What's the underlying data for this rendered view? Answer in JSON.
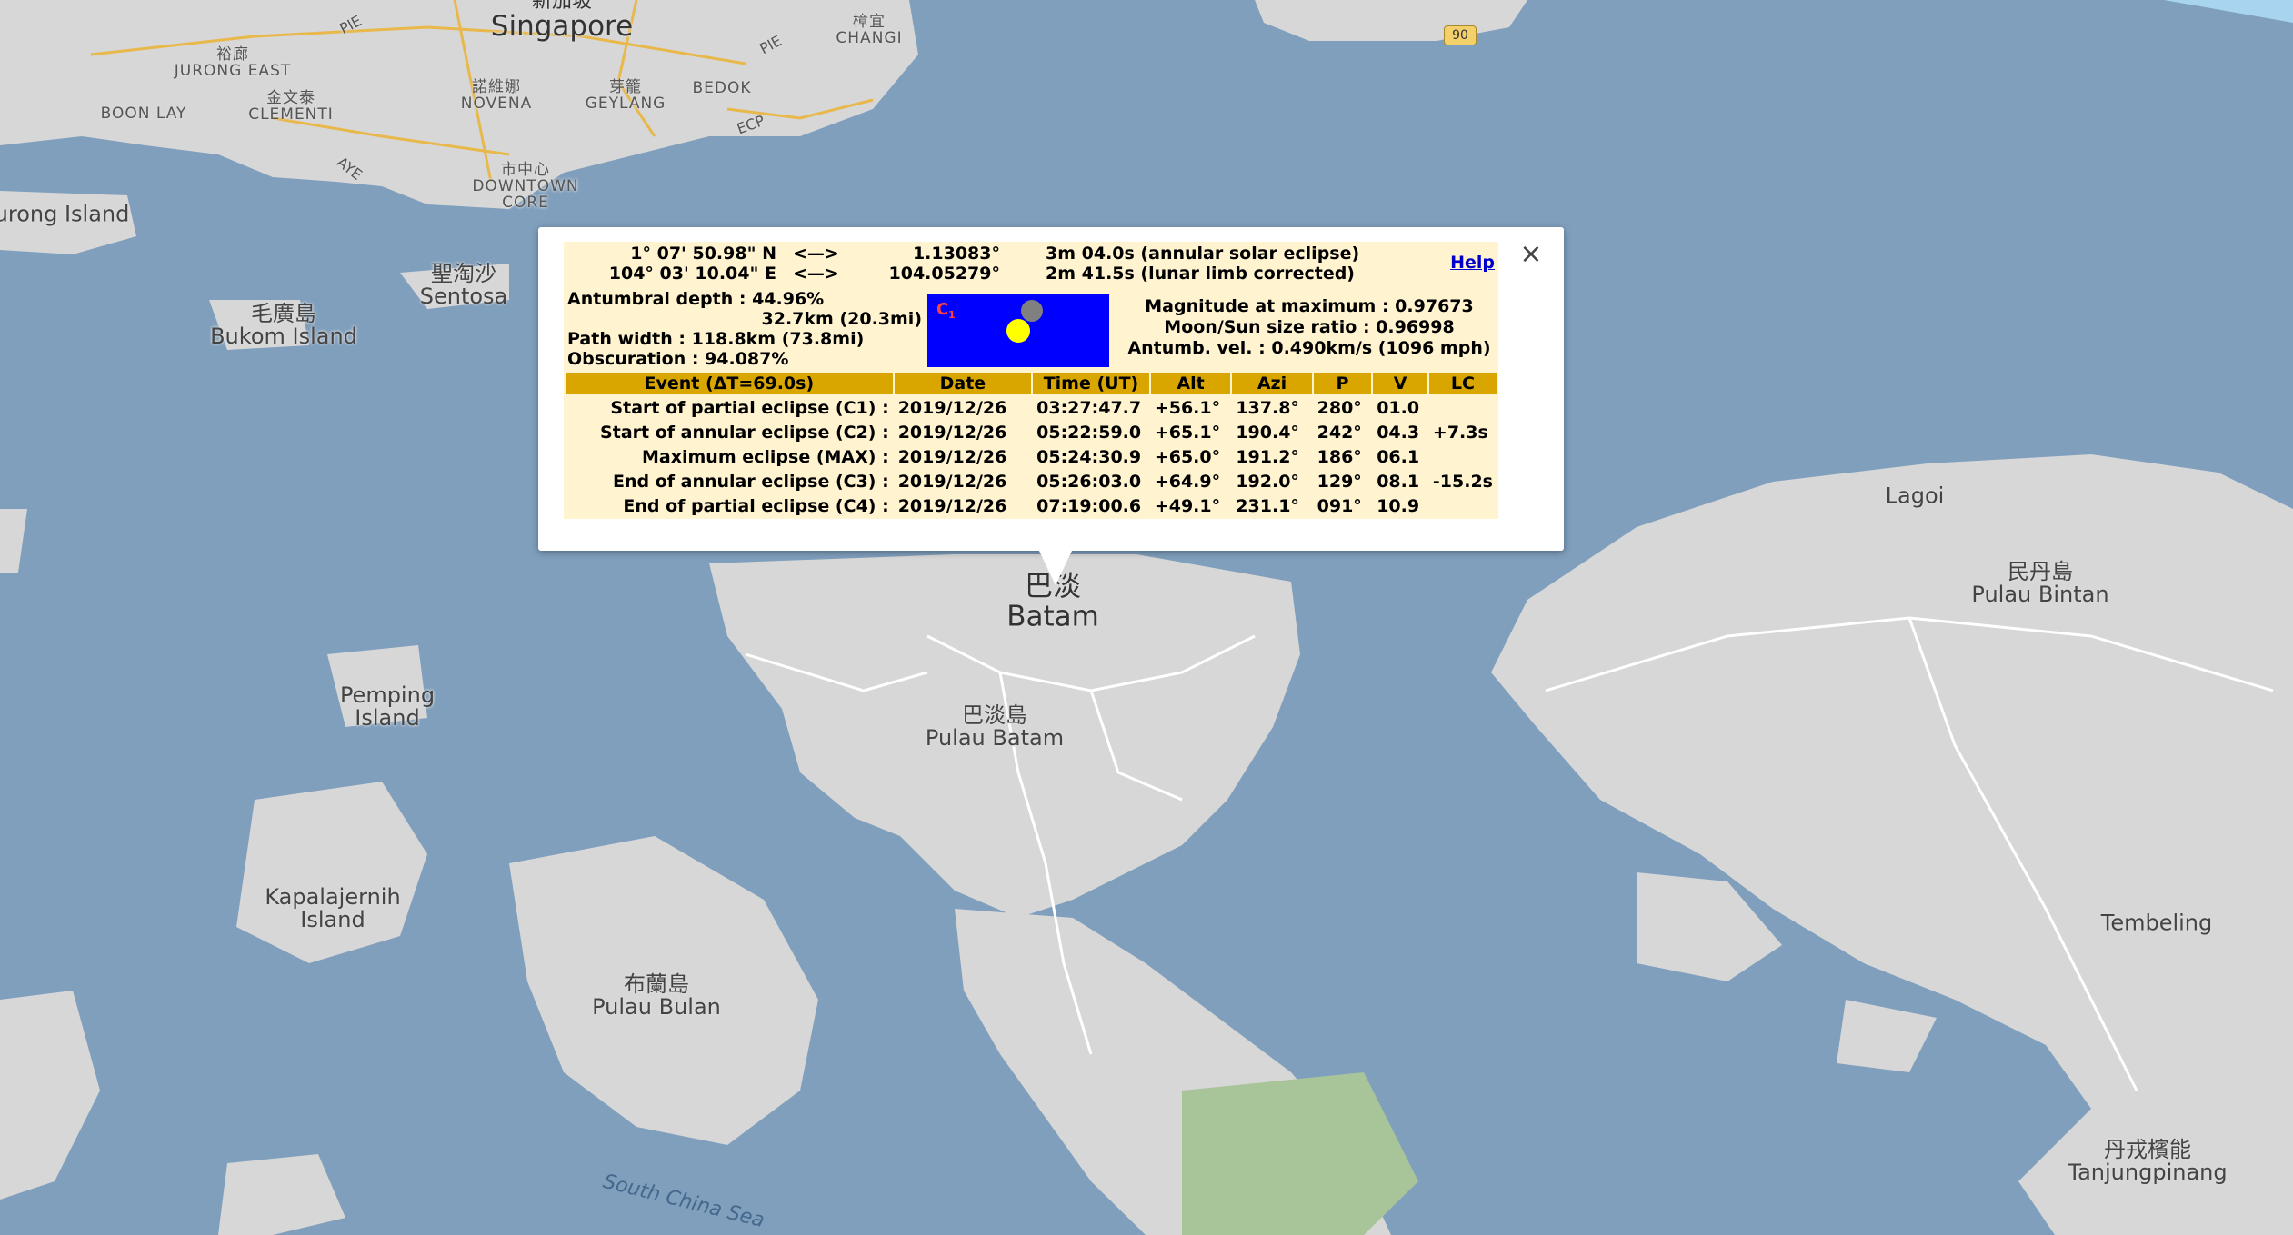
{
  "map": {
    "places": [
      {
        "cn": "新加坡",
        "en": "Singapore",
        "size": "big"
      },
      {
        "cn": "裕廊",
        "en": "JURONG EAST",
        "size": "small"
      },
      {
        "cn": "",
        "en": "BOON LAY",
        "size": "small"
      },
      {
        "cn": "金文泰",
        "en": "CLEMENTI",
        "size": "small"
      },
      {
        "cn": "諾維娜",
        "en": "NOVENA",
        "size": "small"
      },
      {
        "cn": "芽籠",
        "en": "GEYLANG",
        "size": "small"
      },
      {
        "cn": "",
        "en": "BEDOK",
        "size": "small"
      },
      {
        "cn": "樟宜",
        "en": "CHANGI",
        "size": "small"
      },
      {
        "cn": "市中心",
        "en": "DOWNTOWN CORE",
        "size": "small"
      },
      {
        "cn": "",
        "en": "urong Island",
        "size": "med"
      },
      {
        "cn": "聖淘沙",
        "en": "Sentosa",
        "size": "med"
      },
      {
        "cn": "毛廣島",
        "en": "Bukom Island",
        "size": "med"
      },
      {
        "cn": "巴淡",
        "en": "Batam",
        "size": "big"
      },
      {
        "cn": "巴淡島",
        "en": "Pulau Batam",
        "size": "med"
      },
      {
        "cn": "",
        "en": "Pemping Island",
        "size": "med"
      },
      {
        "cn": "",
        "en": "Kapalajernih Island",
        "size": "med"
      },
      {
        "cn": "布蘭島",
        "en": "Pulau Bulan",
        "size": "med"
      },
      {
        "cn": "",
        "en": "Lagoi",
        "size": "med"
      },
      {
        "cn": "民丹島",
        "en": "Pulau Bintan",
        "size": "med"
      },
      {
        "cn": "",
        "en": "Tembeling",
        "size": "med"
      },
      {
        "cn": "丹戎檳能",
        "en": "Tanjungpinang",
        "size": "med"
      },
      {
        "cn": "",
        "en": "South China Sea",
        "size": "sea"
      }
    ],
    "roads": [
      "PIE",
      "PIE",
      "AYE",
      "ECP"
    ],
    "shield": "90",
    "colors": {
      "sea": "#7f9fbd",
      "land": "#d7d7d7",
      "green": "#a8c59a",
      "road": "#e8b84a"
    }
  },
  "popup": {
    "lat_dms": "1° 07' 50.98\" N",
    "lon_dms": "104° 03' 10.04\" E",
    "arrow": "<—>",
    "lat_dec": "1.13083°",
    "lon_dec": "104.05279°",
    "duration": "3m 04.0s (annular solar eclipse)",
    "duration_corrected": "2m 41.5s (lunar limb corrected)",
    "help": "Help",
    "antumbral_depth": "Antumbral depth : 44.96%",
    "antumbral_depth_km": "32.7km (20.3mi)",
    "path_width": "Path width : 118.8km (73.8mi)",
    "obscuration": "Obscuration : 94.087%",
    "magnitude": "Magnitude at maximum : 0.97673",
    "size_ratio": "Moon/Sun size ratio : 0.96998",
    "antumb_vel": "Antumb. vel. : 0.490km/s (1096 mph)",
    "diagram_label": "C",
    "diagram_sub": "1",
    "diagram_colors": {
      "bg": "#0000ff",
      "sun": "#ffff00",
      "moon": "#808080",
      "label": "#ff4040"
    },
    "table": {
      "headers": [
        "Event (ΔT=69.0s)",
        "Date",
        "Time (UT)",
        "Alt",
        "Azi",
        "P",
        "V",
        "LC"
      ],
      "rows": [
        [
          "Start of partial eclipse (C1) :",
          "2019/12/26",
          "03:27:47.7",
          "+56.1°",
          "137.8°",
          "280°",
          "01.0",
          ""
        ],
        [
          "Start of annular eclipse (C2) :",
          "2019/12/26",
          "05:22:59.0",
          "+65.1°",
          "190.4°",
          "242°",
          "04.3",
          "+7.3s"
        ],
        [
          "Maximum eclipse (MAX) :",
          "2019/12/26",
          "05:24:30.9",
          "+65.0°",
          "191.2°",
          "186°",
          "06.1",
          ""
        ],
        [
          "End of annular eclipse (C3) :",
          "2019/12/26",
          "05:26:03.0",
          "+64.9°",
          "192.0°",
          "129°",
          "08.1",
          "-15.2s"
        ],
        [
          "End of partial eclipse (C4) :",
          "2019/12/26",
          "07:19:00.6",
          "+49.1°",
          "231.1°",
          "091°",
          "10.9",
          ""
        ]
      ]
    }
  }
}
